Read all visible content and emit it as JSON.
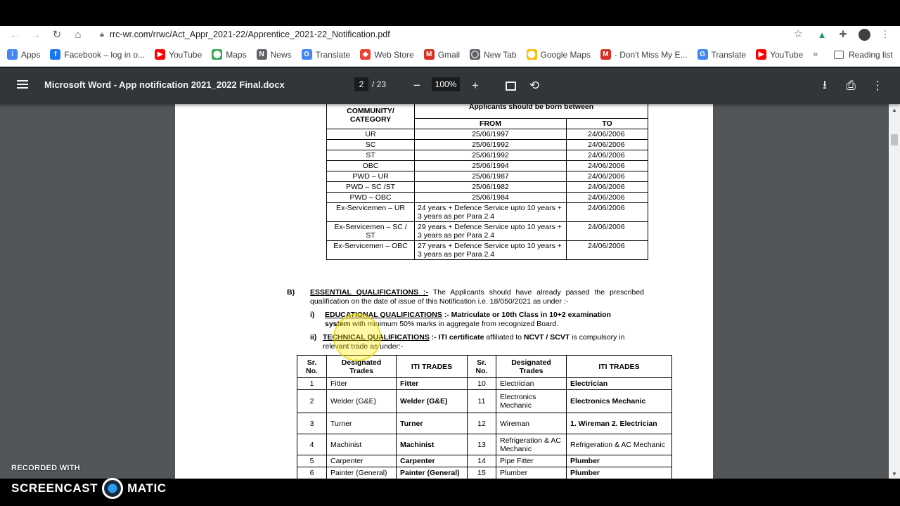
{
  "browser": {
    "url": "rrc-wr.com/rrwc/Act_Appr_2021-22/Apprentice_2021-22_Notification.pdf",
    "bookmarks": [
      {
        "label": "Apps",
        "icon": "apps-grid-icon",
        "color": "#4285f4"
      },
      {
        "label": "Facebook – log in o...",
        "icon": "facebook-icon",
        "color": "#1877f2"
      },
      {
        "label": "YouTube",
        "icon": "youtube-icon",
        "color": "#ff0000"
      },
      {
        "label": "Maps",
        "icon": "maps-pin-icon",
        "color": "#34a853"
      },
      {
        "label": "News",
        "icon": "news-icon",
        "color": "#5f6368"
      },
      {
        "label": "Translate",
        "icon": "translate-icon",
        "color": "#4285f4"
      },
      {
        "label": "Web Store",
        "icon": "web-store-icon",
        "color": "#ea4335"
      },
      {
        "label": "Gmail",
        "icon": "gmail-icon",
        "color": "#d93025"
      },
      {
        "label": "New Tab",
        "icon": "globe-icon",
        "color": "#5f6368"
      },
      {
        "label": "Google Maps",
        "icon": "maps-pin-icon",
        "color": "#fbbc04"
      },
      {
        "label": "· Don't Miss My E...",
        "icon": "gmail-icon",
        "color": "#d93025"
      },
      {
        "label": "Translate",
        "icon": "translate-icon",
        "color": "#4285f4"
      },
      {
        "label": "YouTube",
        "icon": "youtube-icon",
        "color": "#ff0000"
      }
    ],
    "more_label": "»",
    "reading_list": "Reading list"
  },
  "pdf": {
    "title": "Microsoft Word - App notification 2021_2022 Final.docx",
    "page": "2",
    "total": "/ 23",
    "zoom": "100%"
  },
  "age_table": {
    "header_category": "COMMUNITY/ CATEGORY",
    "header_born": "Applicants should be born between",
    "header_from": "FROM",
    "header_to": "TO",
    "rows": [
      {
        "cat": "UR",
        "from": "25/06/1997",
        "to": "24/06/2006"
      },
      {
        "cat": "SC",
        "from": "25/06/1992",
        "to": "24/06/2006"
      },
      {
        "cat": "ST",
        "from": "25/06/1992",
        "to": "24/06/2006"
      },
      {
        "cat": "OBC",
        "from": "25/06/1994",
        "to": "24/06/2006"
      },
      {
        "cat": "PWD – UR",
        "from": "25/06/1987",
        "to": "24/06/2006"
      },
      {
        "cat": "PWD – SC /ST",
        "from": "25/06/1982",
        "to": "24/06/2006"
      },
      {
        "cat": "PWD – OBC",
        "from": "25/06/1984",
        "to": "24/06/2006"
      },
      {
        "cat": "Ex-Servicemen – UR",
        "from": "24 years + Defence Service upto 10 years + 3 years as per Para 2.4",
        "to": "24/06/2006"
      },
      {
        "cat": "Ex-Servicemen – SC / ST",
        "from": "29 years + Defence Service upto 10 years + 3 years as per Para 2.4",
        "to": "24/06/2006"
      },
      {
        "cat": "Ex-Servicemen – OBC",
        "from": "27 years + Defence Service upto 10 years + 3 years as per Para 2.4",
        "to": "24/06/2006"
      }
    ]
  },
  "section_b": {
    "marker": "B)",
    "heading": "ESSENTIAL QUALIFICATIONS :-",
    "text": " The Applicants should have already passed the prescribed qualification on the date of issue of this Notification i.e. 18/050/2021 as under :-",
    "i_marker": "i)",
    "i_heading": "EDUCATIONAL QUALIFICATIONS",
    "i_bold": " :- Matriculate or 10th Class in 10+2 examination system",
    "i_text": " with minimum 50% marks in aggregate from recognized Board.",
    "ii_marker": "ii)",
    "ii_heading": "TECHNICAL QUALIFICATIONS",
    "ii_bold1": " :- ITI certificate",
    "ii_text1": " affiliated to ",
    "ii_bold2": "NCVT / SCVT",
    "ii_text2": " is compulsory in relevant trade as under:-"
  },
  "trades_table": {
    "headers": [
      "Sr. No.",
      "Designated Trades",
      "ITI TRADES",
      "Sr. No.",
      "Designated Trades",
      "ITI TRADES"
    ],
    "rows": [
      {
        "n1": "1",
        "d1": "Fitter",
        "i1": "Fitter",
        "n2": "10",
        "d2": "Electrician",
        "i2": "Electrician"
      },
      {
        "n1": "2",
        "d1": "Welder (G&E)",
        "i1": "Welder (G&E)",
        "n2": "11",
        "d2": "Electronics Mechanic",
        "i2": "Electronics Mechanic"
      },
      {
        "n1": "3",
        "d1": "Turner",
        "i1": "Turner",
        "n2": "12",
        "d2": "Wireman",
        "i2": "1. Wireman 2. Electrician"
      },
      {
        "n1": "4",
        "d1": "Machinist",
        "i1": "Machinist",
        "n2": "13",
        "d2": "Refrigeration & AC Mechanic",
        "i2": "Refrigeration & AC Mechanic"
      },
      {
        "n1": "5",
        "d1": "Carpenter",
        "i1": "Carpenter",
        "n2": "14",
        "d2": "Pipe Fitter",
        "i2": "Plumber"
      },
      {
        "n1": "6",
        "d1": "Painter (General)",
        "i1": "Painter (General)",
        "n2": "15",
        "d2": "Plumber",
        "i2": "Plumber"
      }
    ]
  },
  "watermark": {
    "recorded": "RECORDED WITH",
    "brand_left": "SCREENCAST",
    "brand_right": "MATIC"
  }
}
